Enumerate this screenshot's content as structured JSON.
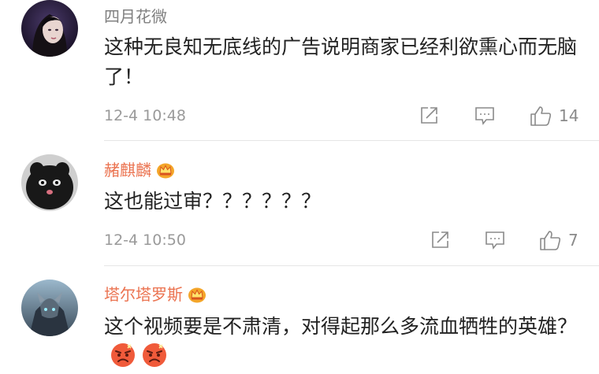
{
  "comments": [
    {
      "username": "四月花微",
      "vip": false,
      "text": "这种无良知无底线的广告说明商家已经利欲熏心而无脑了！",
      "time": "12-4 10:48",
      "likes": "14"
    },
    {
      "username": "赭麒麟",
      "vip": true,
      "text": "这也能过审？？？？？？",
      "time": "12-4 10:50",
      "likes": "7"
    },
    {
      "username": "塔尔塔罗斯",
      "vip": true,
      "text": "这个视频要是不肃清，对得起那么多流血牺牲的英雄？",
      "emojis": [
        "angry-face-emoji",
        "angry-face-emoji"
      ]
    }
  ],
  "colors": {
    "vip_name": "#eb7350",
    "plain_name": "#808080",
    "meta_text": "#9a9a9a",
    "icon": "#8a8a8a"
  },
  "icons": [
    "share-icon",
    "comment-icon",
    "like-icon",
    "vip-crown-icon"
  ]
}
